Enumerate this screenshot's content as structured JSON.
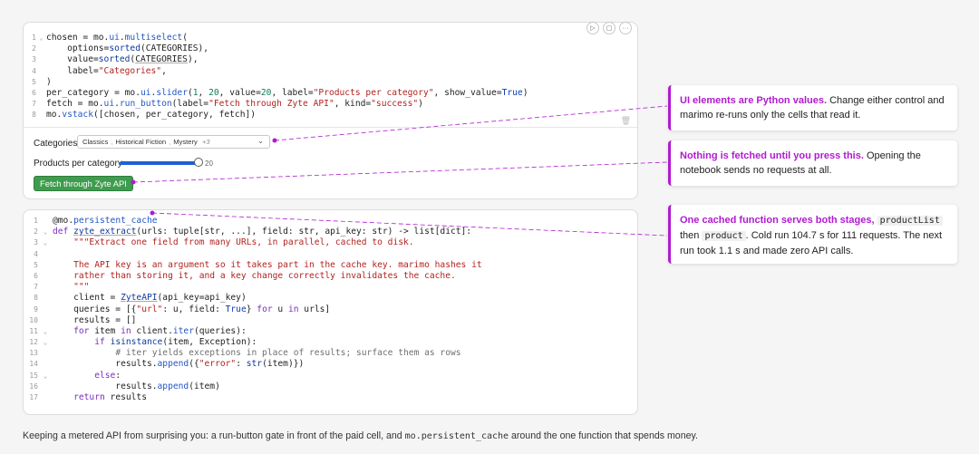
{
  "cell1": {
    "toolbar": {
      "run_icon": "▷",
      "stop_icon": "▢",
      "more_icon": "···"
    },
    "lines": [
      {
        "n": "1",
        "fold": "⌄",
        "html": "chosen = mo.<span class=\"attr\">ui</span>.<span class=\"attr\">multiselect</span>("
      },
      {
        "n": "2",
        "fold": "",
        "html": "    options=<span class=\"fn\">sorted</span>(CATEGORIES),"
      },
      {
        "n": "3",
        "fold": "",
        "html": "    value=<span class=\"fn\">sorted</span>(<span class=\"und\">CATEGORIES</span>),"
      },
      {
        "n": "4",
        "fold": "",
        "html": "    label=<span class=\"str\">\"Categories\"</span>,"
      },
      {
        "n": "5",
        "fold": "",
        "html": ")"
      },
      {
        "n": "6",
        "fold": "",
        "html": "per_category = mo.<span class=\"attr\">ui</span>.<span class=\"attr\">slider</span>(<span class=\"num\">1</span>, <span class=\"num\">20</span>, value=<span class=\"num\">20</span>, label=<span class=\"str\">\"Products per category\"</span>, show_value=<span class=\"kw2\">True</span>)"
      },
      {
        "n": "7",
        "fold": "",
        "html": "fetch = mo.<span class=\"attr\">ui</span>.<span class=\"attr\">run_button</span>(label=<span class=\"str\">\"Fetch through Zyte API\"</span>, kind=<span class=\"str\">\"success\"</span>)"
      },
      {
        "n": "8",
        "fold": "",
        "html": "mo.<span class=\"attr\">vstack</span>([chosen, per_category, fetch])"
      }
    ],
    "categories_label": "Categories",
    "selected_chips": [
      "Classics",
      "Historical Fiction",
      "Mystery"
    ],
    "more_count": "+3",
    "slider_label": "Products per category",
    "slider_value": "20",
    "slider_fraction": 1.0,
    "run_button_label": "Fetch through Zyte API"
  },
  "cell2": {
    "lines": [
      {
        "n": "1",
        "fold": "",
        "html": "@mo.<span class=\"attr\">persistent_cache</span>"
      },
      {
        "n": "2",
        "fold": "⌄",
        "html": "<span class=\"kw\">def</span> <span class=\"fn und\">zyte_extract</span>(urls: tuple[str, ...], field: str, api_key: str) -&gt; list[dict]:"
      },
      {
        "n": "3",
        "fold": "⌄",
        "html": "    <span class=\"str\">\"\"\"Extract one field from many URLs, in parallel, cached to disk.</span>"
      },
      {
        "n": "4",
        "fold": "",
        "html": ""
      },
      {
        "n": "5",
        "fold": "",
        "html": "<span class=\"str\">    The API key is an argument so it takes part in the cache key. marimo hashes it</span>"
      },
      {
        "n": "6",
        "fold": "",
        "html": "<span class=\"str\">    rather than storing it, and a key change correctly invalidates the cache.</span>"
      },
      {
        "n": "7",
        "fold": "",
        "html": "<span class=\"str\">    \"\"\"</span>"
      },
      {
        "n": "8",
        "fold": "",
        "html": "    client = <span class=\"fn und\">ZyteAPI</span>(api_key=api_key)"
      },
      {
        "n": "9",
        "fold": "",
        "html": "    queries = [{<span class=\"str\">\"url\"</span>: u, field: <span class=\"kw2\">True</span>} <span class=\"kw\">for</span> u <span class=\"kw\">in</span> urls]"
      },
      {
        "n": "10",
        "fold": "",
        "html": "    results = []"
      },
      {
        "n": "11",
        "fold": "⌄",
        "html": "    <span class=\"kw\">for</span> item <span class=\"kw\">in</span> client.<span class=\"attr\">iter</span>(queries):"
      },
      {
        "n": "12",
        "fold": "⌄",
        "html": "        <span class=\"kw\">if</span> <span class=\"fn\">isinstance</span>(item, Exception):"
      },
      {
        "n": "13",
        "fold": "",
        "html": "            <span class=\"cmt\"># iter yields exceptions in place of results; surface them as rows</span>"
      },
      {
        "n": "14",
        "fold": "",
        "html": "            results.<span class=\"attr\">append</span>({<span class=\"str\">\"error\"</span>: <span class=\"fn\">str</span>(item)})"
      },
      {
        "n": "15",
        "fold": "⌄",
        "html": "        <span class=\"kw\">else</span>:"
      },
      {
        "n": "16",
        "fold": "",
        "html": "            results.<span class=\"attr\">append</span>(item)"
      },
      {
        "n": "17",
        "fold": "",
        "html": "    <span class=\"kw\">return</span> results"
      }
    ]
  },
  "callouts": [
    {
      "highlight": "UI elements are Python values.",
      "rest": " Change either control and marimo re-runs only the cells that read it."
    },
    {
      "highlight": "Nothing is fetched until you press this.",
      "rest": " Opening the notebook sends no requests at all."
    },
    {
      "highlight": "One cached function serves both stages,",
      "code1": "productList",
      "mid": " then ",
      "code2": "product",
      "rest": ". Cold run 104.7 s for 111 requests. The next run took 1.1 s and made zero API calls."
    }
  ],
  "caption": {
    "before": "Keeping a metered API from surprising you: a run-button gate in front of the paid cell, and ",
    "code": "mo.persistent_cache",
    "after": " around the one function that spends money."
  },
  "colors": {
    "accent": "#b01bd0",
    "run_button": "#3f9c4f",
    "slider": "#1f5fd6"
  }
}
